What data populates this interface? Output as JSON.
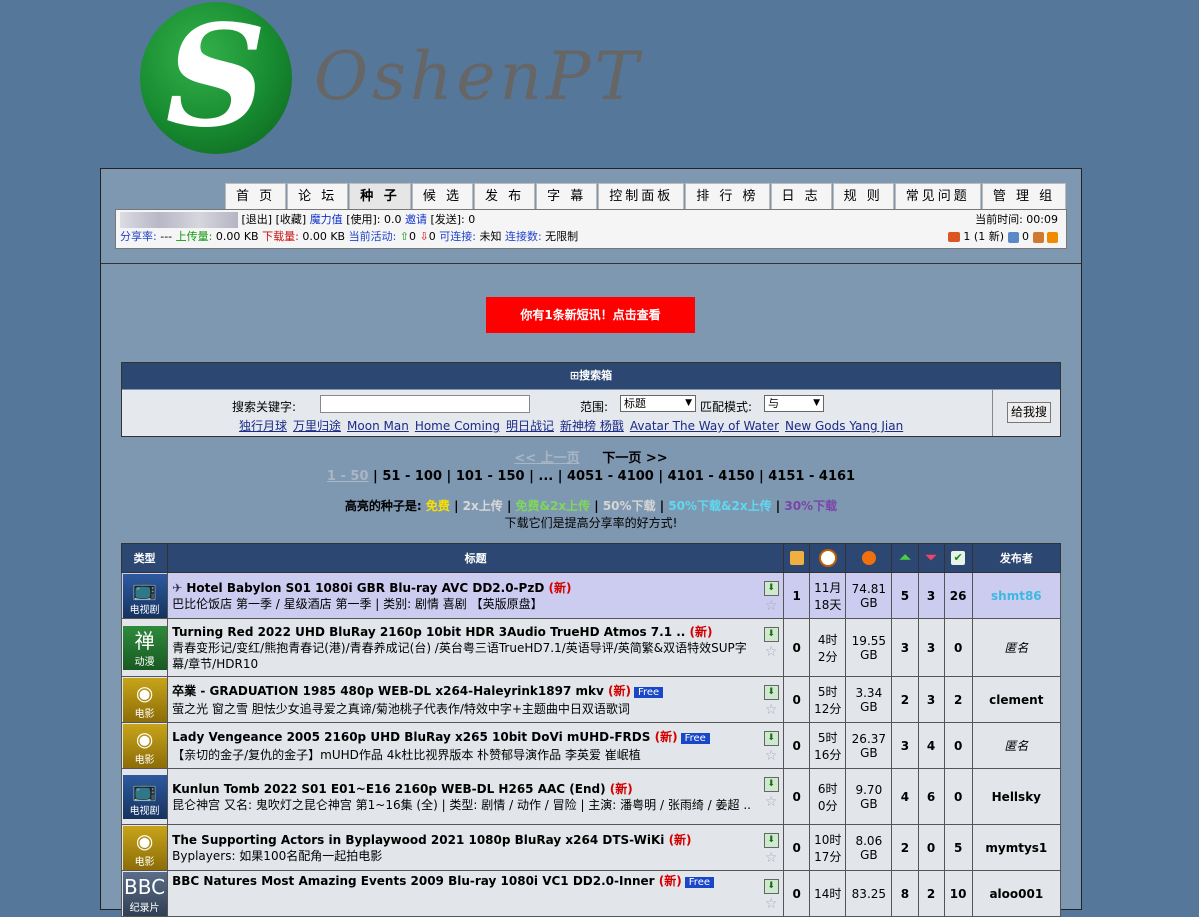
{
  "site": {
    "name": "OshenPT"
  },
  "nav": [
    "首 页",
    "论 坛",
    "种 子",
    "候 选",
    "发 布",
    "字 幕",
    "控制面板",
    "排 行 榜",
    "日 志",
    "规 则",
    "常见问题",
    "管 理 组"
  ],
  "user": {
    "logout": "退出",
    "favorites": "收藏",
    "bonus_label": "魔力值",
    "used_label": "[使用]: 0.0",
    "invite_label": "邀请",
    "sent_label": "[发送]: 0",
    "share_ratio_label": "分享率:",
    "share_ratio": "---",
    "upload_label": "上传量:",
    "upload": "0.00 KB",
    "download_label": "下载量:",
    "download": "0.00 KB",
    "activity_label": "当前活动:",
    "activity_up": "0",
    "activity_down": "0",
    "connectable_label": "可连接:",
    "connectable": "未知",
    "connections_label": "连接数:",
    "connections": "无限制",
    "time_label": "当前时间:",
    "time": "00:09",
    "messages": "1 (1 新)",
    "msg_count": "0"
  },
  "notice": "你有1条新短讯！点击查看",
  "search": {
    "header": "搜索箱",
    "keyword_label": "搜索关键字:",
    "keyword_value": "",
    "range_label": "范围:",
    "range_value": "标题",
    "match_label": "匹配模式:",
    "match_value": "与",
    "quick": [
      "独行月球",
      "万里归途",
      "Moon Man",
      "Home Coming",
      "明日战记",
      "新神榜 杨戬",
      "Avatar The Way of Water",
      "New Gods Yang Jian"
    ],
    "button": "给我搜"
  },
  "pager": {
    "prev": "<< 上一页",
    "next": "下一页 >>",
    "pages": [
      "1 - 50",
      "51 - 100",
      "101 - 150",
      "...",
      "4051 - 4100",
      "4101 - 4150",
      "4151 - 4161"
    ]
  },
  "legend": {
    "label": "高亮的种子是:",
    "items": [
      {
        "text": "免费",
        "color": "#f7e000"
      },
      {
        "text": "2x上传",
        "color": "#d8d8d8"
      },
      {
        "text": "免费&2x上传",
        "color": "#7ed85a"
      },
      {
        "text": "50%下载",
        "color": "#d5d5d5"
      },
      {
        "text": "50%下载&2x上传",
        "color": "#5ed9f0"
      },
      {
        "text": "30%下载",
        "color": "#7a44aa"
      }
    ],
    "note": "下载它们是提高分享率的好方式!"
  },
  "table": {
    "headers": [
      "类型",
      "标题",
      "",
      "",
      "",
      "",
      "",
      "",
      "发布者"
    ],
    "rows": [
      {
        "cat": "tv",
        "cat_label": "电视剧",
        "cat_icon": "tv-icon",
        "title": "Hotel Babylon S01 1080i GBR Blu-ray AVC DD2.0-PzD",
        "new": "(新)",
        "free": "",
        "sub": "巴比伦饭店 第一季 / 星级酒店 第一季 | 类别: 剧情 喜剧 【英版原盘】",
        "comments": "1",
        "time": "11月\n18天",
        "size": "74.81\nGB",
        "seeders": "5",
        "leechers": "3",
        "completed": "26",
        "uploader": "shmt86",
        "highlight": true,
        "pinned": true
      },
      {
        "cat": "anime",
        "cat_label": "动漫",
        "cat_icon": "anime-icon",
        "title": "Turning Red 2022 UHD BluRay 2160p 10bit HDR 3Audio TrueHD Atmos 7.1 ..",
        "new": "(新)",
        "free": "",
        "sub": "青春变形记/变红/熊抱青春记(港)/青春养成记(台) /英台粤三语TrueHD7.1/英语导评/英简繁&双语特效SUP字幕/章节/HDR10",
        "comments": "0",
        "time": "4时\n2分",
        "size": "19.55\nGB",
        "seeders": "3",
        "leechers": "3",
        "completed": "0",
        "uploader": "匿名",
        "highlight": false,
        "pinned": false
      },
      {
        "cat": "movie",
        "cat_label": "电影",
        "cat_icon": "movie-icon",
        "title": "卒業 - GRADUATION 1985 480p WEB-DL x264-Haleyrink1897 mkv",
        "new": "(新)",
        "free": "Free",
        "sub": "萤之光 窗之雪 胆怯少女追寻爱之真谛/菊池桃子代表作/特效中字+主题曲中日双语歌词",
        "comments": "0",
        "time": "5时\n12分",
        "size": "3.34\nGB",
        "seeders": "2",
        "leechers": "3",
        "completed": "2",
        "uploader": "clement",
        "highlight": false,
        "pinned": false
      },
      {
        "cat": "movie",
        "cat_label": "电影",
        "cat_icon": "movie-icon",
        "title": "Lady Vengeance 2005 2160p UHD BluRay x265 10bit DoVi mUHD-FRDS",
        "new": "(新)",
        "free": "Free",
        "sub": "【亲切的金子/复仇的金子】mUHD作品 4k杜比视界版本 朴赞郁导演作品 李英爱 崔岷植",
        "comments": "0",
        "time": "5时\n16分",
        "size": "26.37\nGB",
        "seeders": "3",
        "leechers": "4",
        "completed": "0",
        "uploader": "匿名",
        "highlight": false,
        "pinned": false
      },
      {
        "cat": "tv",
        "cat_label": "电视剧",
        "cat_icon": "tv-icon",
        "title": "Kunlun Tomb 2022 S01 E01~E16 2160p WEB-DL H265 AAC (End)",
        "new": "(新)",
        "free": "",
        "sub": "昆仑神宫 又名: 鬼吹灯之昆仑神宫 第1~16集 (全) | 类型: 剧情 / 动作 / 冒险 | 主演: 潘粤明 / 张雨绮 / 姜超 ..",
        "comments": "0",
        "time": "6时\n0分",
        "size": "9.70\nGB",
        "seeders": "4",
        "leechers": "6",
        "completed": "0",
        "uploader": "Hellsky",
        "highlight": false,
        "pinned": false
      },
      {
        "cat": "movie",
        "cat_label": "电影",
        "cat_icon": "movie-icon",
        "title": "The Supporting Actors in Byplaywood 2021 1080p BluRay x264 DTS-WiKi",
        "new": "(新)",
        "free": "",
        "sub": "Byplayers: 如果100名配角一起拍电影",
        "comments": "0",
        "time": "10时\n17分",
        "size": "8.06\nGB",
        "seeders": "2",
        "leechers": "0",
        "completed": "5",
        "uploader": "mymtys1",
        "highlight": false,
        "pinned": false
      },
      {
        "cat": "doc",
        "cat_label": "纪录片",
        "cat_icon": "bbc-icon",
        "title": "BBC Natures Most Amazing Events 2009 Blu-ray 1080i VC1 DD2.0-Inner",
        "new": "(新)",
        "free": "Free",
        "sub": "",
        "comments": "0",
        "time": "14时\n",
        "size": "83.25\n",
        "seeders": "8",
        "leechers": "2",
        "completed": "10",
        "uploader": "aloo001",
        "highlight": false,
        "pinned": false
      }
    ]
  },
  "colors": {
    "background": "#557799",
    "header": "#2c4772",
    "notice": "#ff0000"
  }
}
